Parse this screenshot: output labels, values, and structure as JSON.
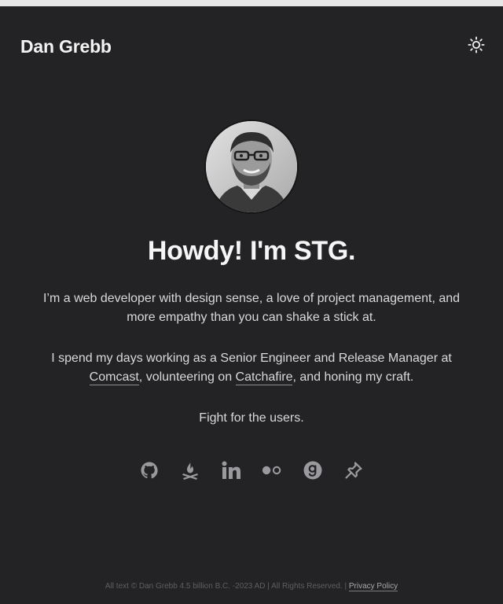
{
  "header": {
    "brand": "Dan Grebb",
    "theme_icon": "sun-icon"
  },
  "hero": {
    "avatar_alt": "Dan Grebb",
    "title": "Howdy! I'm STG."
  },
  "intro": {
    "text": "I’m a web developer with design sense, a love of project management, and more empathy than you can shake a stick at."
  },
  "work": {
    "text_before": "I spend my days working as a Senior Engineer and Release Manager at ",
    "link1": "Comcast",
    "text_middle": ", volunteering on ",
    "link2": "Catchafire",
    "text_after": ", and honing my craft."
  },
  "motto": {
    "text": "Fight for the users."
  },
  "social": [
    {
      "name": "github-icon"
    },
    {
      "name": "campfire-icon"
    },
    {
      "name": "linkedin-icon"
    },
    {
      "name": "flickr-icon"
    },
    {
      "name": "goodreads-icon"
    },
    {
      "name": "pinboard-icon"
    }
  ],
  "footer": {
    "copyright": "All text © Dan Grebb 4.5 billion B.C. -2023 AD | All Rights Reserved. | ",
    "privacy_label": "Privacy Policy"
  },
  "colors": {
    "background": "#232325",
    "text": "#e4e4e6",
    "icon": "#9a9a9e"
  }
}
